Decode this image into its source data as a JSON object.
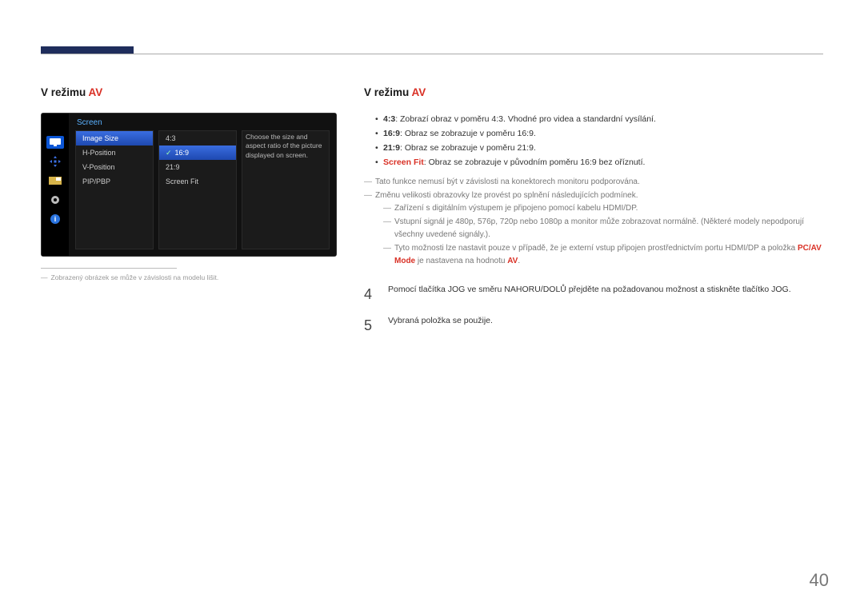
{
  "page_number": "40",
  "heading_left": {
    "prefix": "V režimu ",
    "av": "AV"
  },
  "heading_right": {
    "prefix": "V režimu ",
    "av": "AV"
  },
  "osd": {
    "title": "Screen",
    "left_items": [
      "Image Size",
      "H-Position",
      "V-Position",
      "PIP/PBP"
    ],
    "right_items": [
      "4:3",
      "16:9",
      "21:9",
      "Screen Fit"
    ],
    "help": "Choose the size and aspect ratio of the picture displayed on screen."
  },
  "left_footnote": "Zobrazený obrázek se může v závislosti na modelu lišit.",
  "bullets": {
    "b43_label": "4:3",
    "b43_text": ": Zobrazí obraz v poměru 4:3. Vhodné pro videa a standardní vysílání.",
    "b169_label": "16:9",
    "b169_text": ": Obraz se zobrazuje v poměru 16:9.",
    "b219_label": "21:9",
    "b219_text": ": Obraz se zobrazuje v poměru 21:9.",
    "bfit_label": "Screen Fit",
    "bfit_text": ": Obraz se zobrazuje v původním poměru 16:9 bez oříznutí."
  },
  "notes": {
    "n1": "Tato funkce nemusí být v závislosti na konektorech monitoru podporována.",
    "n2": "Změnu velikosti obrazovky lze provést po splnění následujících podmínek.",
    "n2a": "Zařízení s digitálním výstupem je připojeno pomocí kabelu HDMI/DP.",
    "n2b": "Vstupní signál je 480p, 576p, 720p nebo 1080p a monitor může zobrazovat normálně. (Některé modely nepodporují všechny uvedené signály.).",
    "n2c_a": "Tyto možnosti lze nastavit pouze v případě, že je externí vstup připojen prostřednictvím portu HDMI/DP a položka ",
    "n2c_pc": "PC/AV Mode",
    "n2c_b": " je nastavena na hodnotu ",
    "n2c_av": "AV",
    "n2c_c": "."
  },
  "steps": {
    "s4": "Pomocí tlačítka JOG ve směru NAHORU/DOLŮ přejděte na požadovanou možnost a stiskněte tlačítko JOG.",
    "s5": "Vybraná položka se použije."
  }
}
